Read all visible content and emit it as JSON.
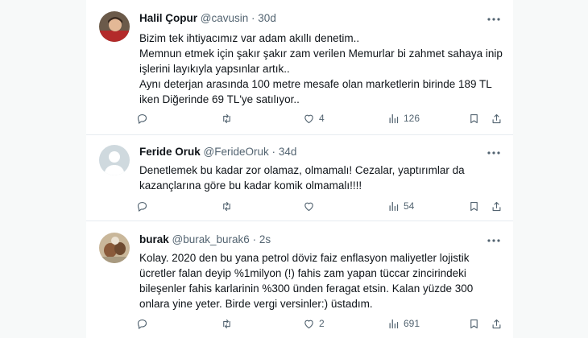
{
  "tweets": [
    {
      "name": "Halil Çopur",
      "handle": "@cavusin",
      "separator": "·",
      "time": "30d",
      "text_lines": [
        "Bizim tek ihtiyacımız var adam akıllı denetim..",
        "Memnun etmek için şakır şakır zam verilen Memurlar bi zahmet sahaya inip",
        "işlerini layıkıyla yapsınlar artık..",
        "Aynı deterjan arasında 100 metre mesafe olan marketlerin birinde 189 TL",
        "iken Diğerinde 69 TL'ye satılıyor.."
      ],
      "reply_count": "",
      "retweet_count": "",
      "like_count": "4",
      "view_count": "126"
    },
    {
      "name": "Feride Oruk",
      "handle": "@FerideOruk",
      "separator": "·",
      "time": "34d",
      "text_lines": [
        "Denetlemek bu kadar zor olamaz, olmamalı! Cezalar, yaptırımlar da",
        "kazançlarına göre bu kadar komik olmamalı!!!!"
      ],
      "reply_count": "",
      "retweet_count": "",
      "like_count": "",
      "view_count": "54"
    },
    {
      "name": "burak",
      "handle": "@burak_burak6",
      "separator": "·",
      "time": "2s",
      "text_lines": [
        "Kolay. 2020 den bu yana petrol döviz faiz enflasyon maliyetler lojistik",
        "ücretler falan deyip %1milyon (!) fahis zam yapan tüccar zincirindeki",
        "bileşenler fahis karlarinin %300 ünden feragat etsin. Kalan yüzde 300",
        "onlara yine yeter. Birde vergi versinler:) üstadım."
      ],
      "reply_count": "",
      "retweet_count": "",
      "like_count": "2",
      "view_count": "691"
    }
  ],
  "icons": {
    "more": "more-dots-icon",
    "reply": "reply-icon",
    "retweet": "retweet-icon",
    "like": "like-icon",
    "views": "views-icon",
    "bookmark": "bookmark-icon",
    "share": "share-icon"
  },
  "colors": {
    "text": "#0f1419",
    "muted": "#536471",
    "divider": "#e6ecf0",
    "background": "#f7f9f9"
  }
}
